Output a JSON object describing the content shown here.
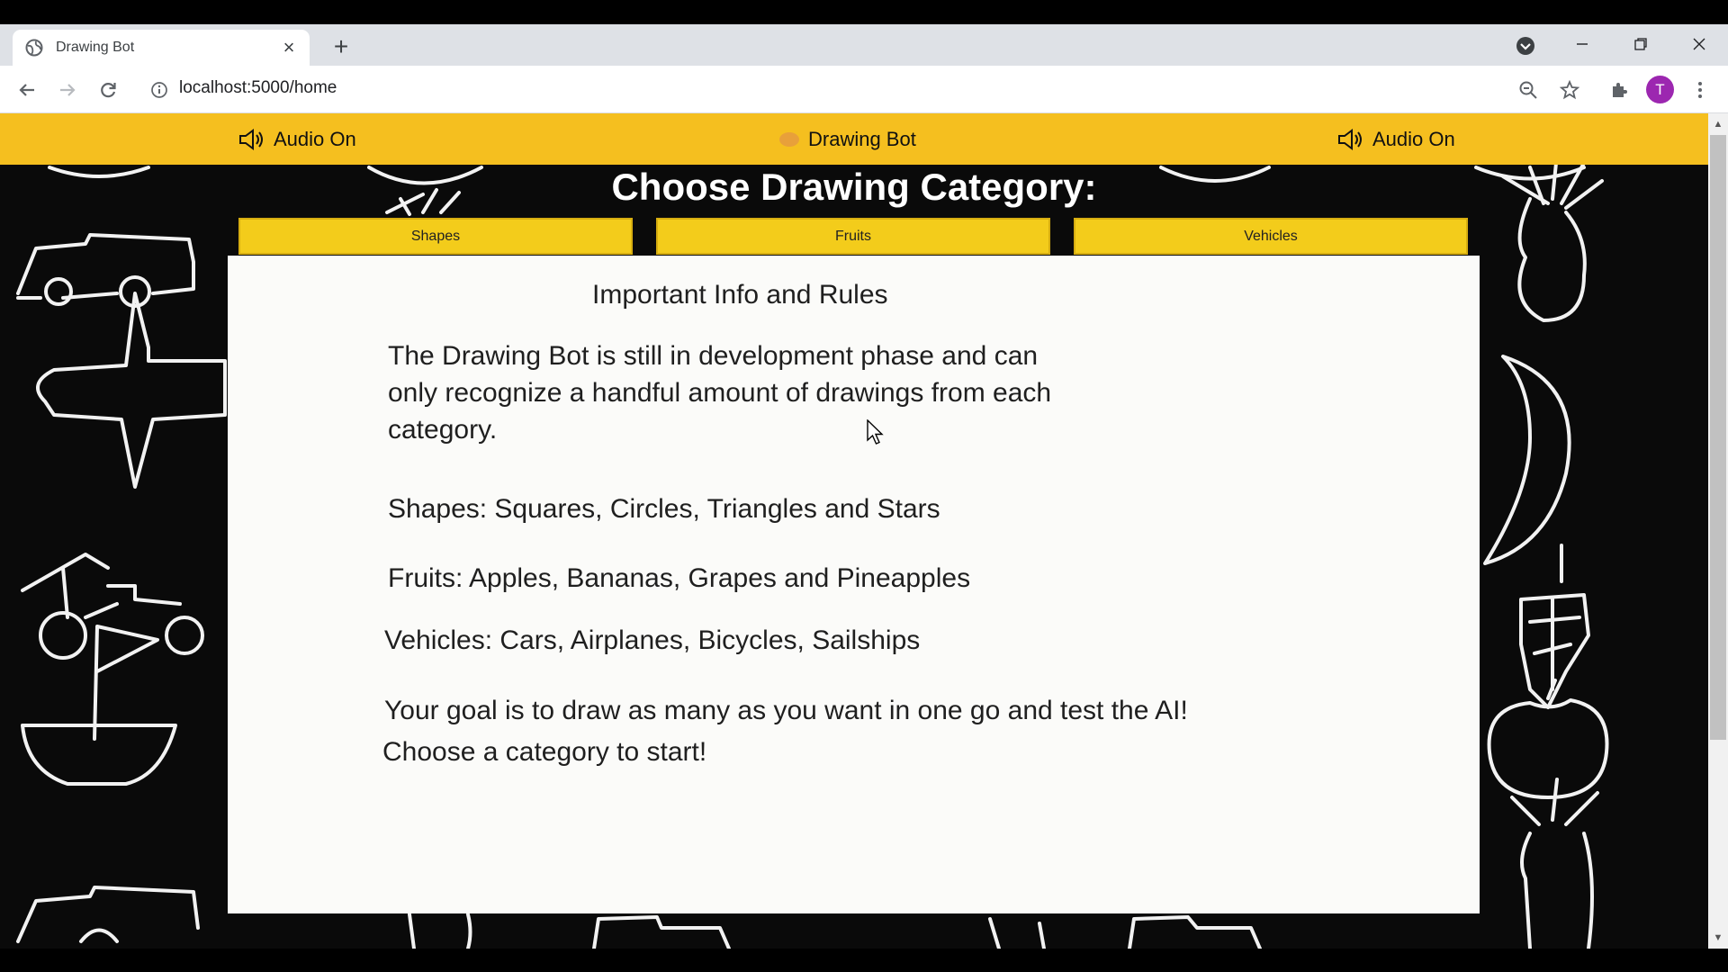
{
  "browser": {
    "tab_title": "Drawing Bot",
    "url": "localhost:5000/home",
    "profile_initial": "T"
  },
  "navbar": {
    "audio_left": "Audio On",
    "center_title": "Drawing Bot",
    "audio_right": "Audio On"
  },
  "page": {
    "heading": "Choose Drawing Category:",
    "categories": [
      "Shapes",
      "Fruits",
      "Vehicles"
    ]
  },
  "info": {
    "title": "Important Info and Rules",
    "intro_lines": [
      "The Drawing Bot is still in development phase and can",
      "only recognize a handful amount of drawings from each",
      "category."
    ],
    "shapes": " Shapes: Squares, Circles, Triangles and Stars",
    "fruits": "Fruits: Apples, Bananas, Grapes and Pineapples",
    "vehicles": "Vehicles: Cars, Airplanes, Bicycles, Sailships",
    "goal_line1": "Your goal is to draw as many as you want in one go and test the AI!",
    "goal_line2": "Choose a category to start!"
  },
  "colors": {
    "navbar_bg": "#f5bf1f",
    "category_button_bg": "#f3cc1b",
    "panel_bg": "#fbfbf9",
    "page_bg": "#0a0a0a"
  }
}
